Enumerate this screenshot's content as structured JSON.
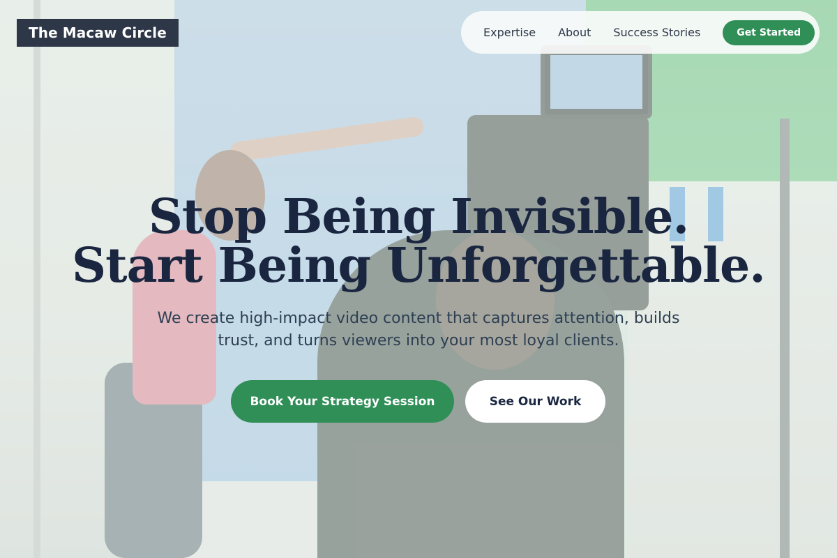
{
  "brand": {
    "name": "The Macaw Circle"
  },
  "nav": {
    "links": [
      "Expertise",
      "About",
      "Success Stories"
    ],
    "cta_label": "Get Started"
  },
  "hero": {
    "headline_line1": "Stop Being Invisible.",
    "headline_line2": "Start Being Unforgettable.",
    "subheadline": "We create high-impact video content that captures attention, builds trust, and turns viewers into your most loyal clients.",
    "primary_cta": "Book Your Strategy Session",
    "secondary_cta": "See Our Work"
  },
  "colors": {
    "brand_bg": "#2d3748",
    "accent_green": "#2f8f57",
    "headline": "#1a2640"
  }
}
